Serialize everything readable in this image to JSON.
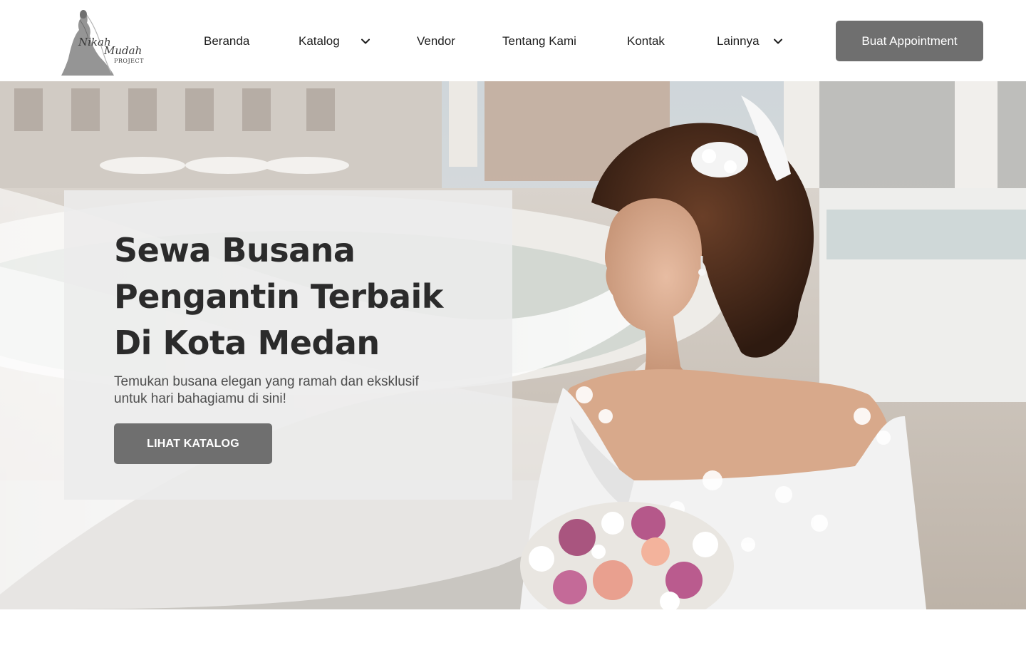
{
  "brand": {
    "logo_alt": "Nikah Mudah Project",
    "logo_script_line1": "Nikah",
    "logo_script_line2": "Mudah",
    "logo_caption": "PROJECT"
  },
  "nav": {
    "items": [
      {
        "label": "Beranda",
        "has_dropdown": false
      },
      {
        "label": "Katalog",
        "has_dropdown": true
      },
      {
        "label": "Vendor",
        "has_dropdown": false
      },
      {
        "label": "Tentang Kami",
        "has_dropdown": false
      },
      {
        "label": "Kontak",
        "has_dropdown": false
      },
      {
        "label": "Lainnya",
        "has_dropdown": true
      }
    ],
    "dropdown_icon": "chevron-down-icon",
    "cta_label": "Buat Appointment"
  },
  "hero": {
    "title_line1": "Sewa Busana",
    "title_line2": "Pengantin Terbaik",
    "title_line3": "Di Kota Medan",
    "subtitle_line1": "Temukan busana elegan yang ramah dan eksklusif",
    "subtitle_line2": "untuk hari bahagiamu di sini!",
    "button_label": "LIHAT KATALOG",
    "background_image": "bride-with-veil-photo"
  },
  "colors": {
    "button": "#6f6f6f",
    "text_dark": "#2b2b2b",
    "text_muted": "#4e4e4e",
    "card": "#ececec"
  }
}
